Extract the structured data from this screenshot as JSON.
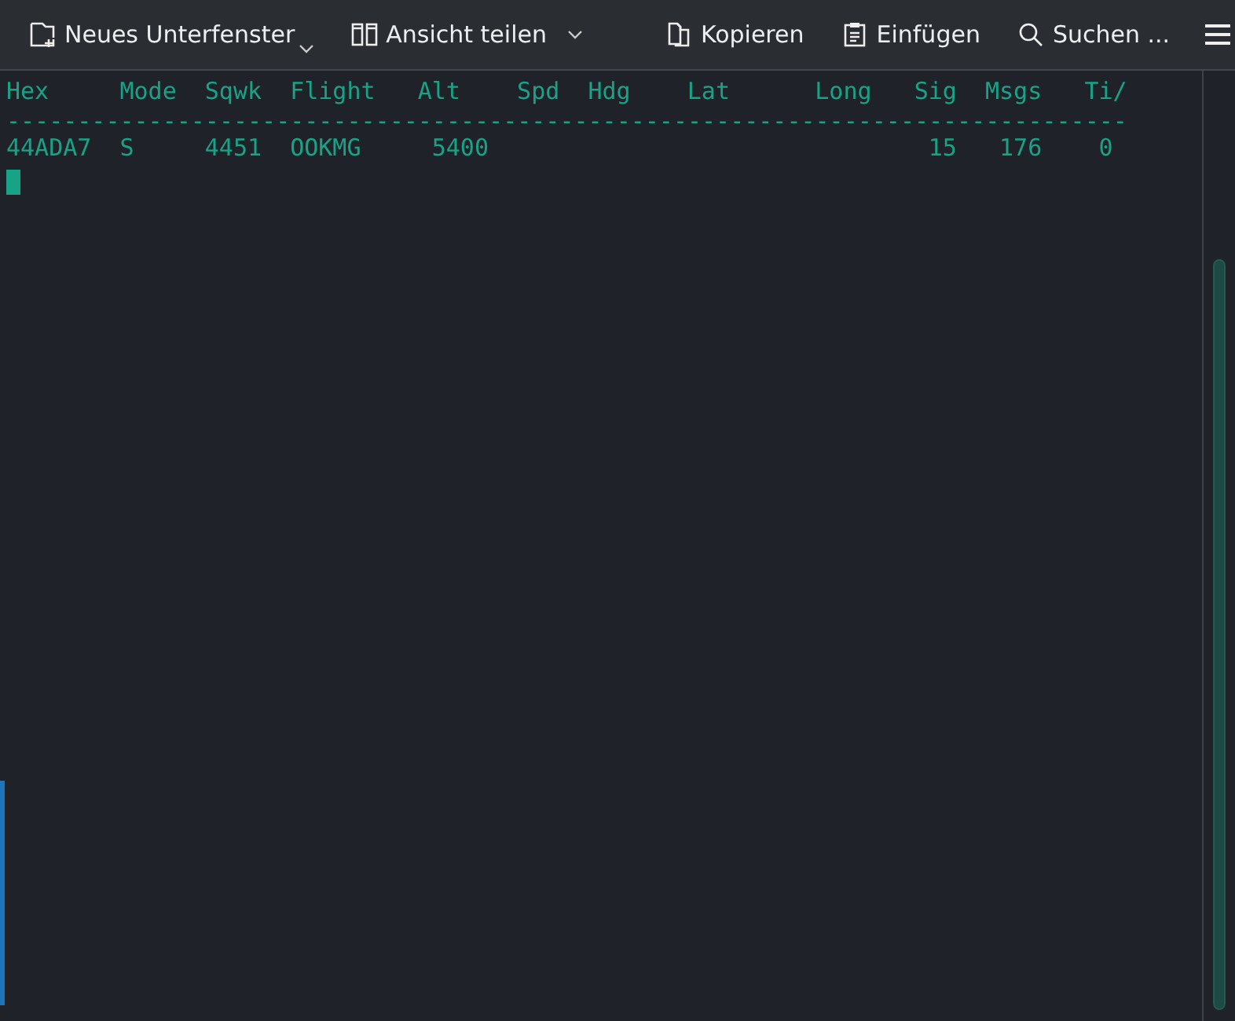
{
  "toolbar": {
    "items": [
      {
        "kind": "new-tab",
        "label": "Neues Unterfenster",
        "dropdown": true
      },
      {
        "kind": "split",
        "label": "Ansicht teilen",
        "dropdown": true
      },
      {
        "kind": "copy",
        "label": "Kopieren",
        "dropdown": false
      },
      {
        "kind": "paste",
        "label": "Einfügen",
        "dropdown": false
      },
      {
        "kind": "search",
        "label": "Suchen ...",
        "dropdown": false
      }
    ]
  },
  "terminal": {
    "columns": [
      "Hex",
      "Mode",
      "Sqwk",
      "Flight",
      "Alt",
      "Spd",
      "Hdg",
      "Lat",
      "Long",
      "Sig",
      "Msgs",
      "Ti/"
    ],
    "separator": "-------------------------------------------------------------------------------",
    "rows": [
      [
        "44ADA7",
        "S",
        "4451",
        "OOKMG",
        "5400",
        "",
        "",
        "",
        "",
        "15",
        "176",
        "0"
      ]
    ],
    "cursor": true
  }
}
